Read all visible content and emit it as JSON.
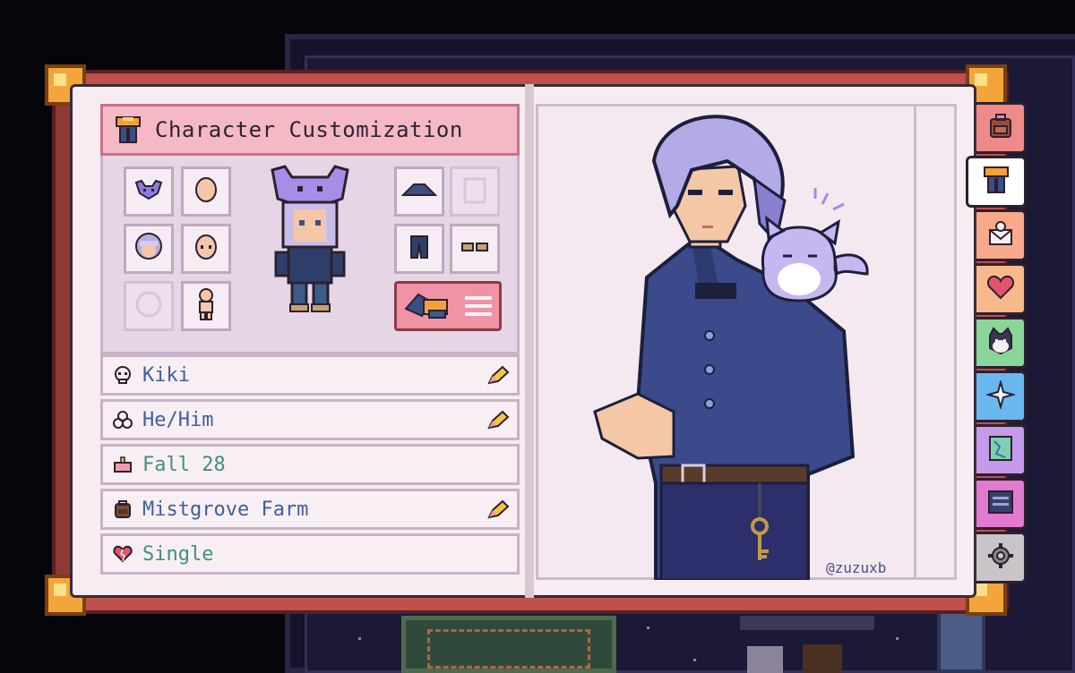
{
  "window": {
    "header_title": "Character Customization"
  },
  "customization": {
    "left_slots": [
      "cat-hat-icon",
      "bald-head-icon",
      "hair-icon",
      "face-icon",
      "empty-accessory-icon",
      "body-icon"
    ],
    "right_slots": [
      "hat-brim-icon",
      "locked-shirt-icon",
      "pants-icon",
      "shoes-icon"
    ],
    "wardrobe_button_icon": "clothes-pile-icon"
  },
  "profile": {
    "name": "Kiki",
    "pronouns": "He/Him",
    "birthday": "Fall 28",
    "farm": "Mistgrove Farm",
    "status": "Single"
  },
  "portrait": {
    "credit": "@zuzuxb"
  },
  "tabs": [
    "backpack-icon",
    "shirt-icon",
    "mail-icon",
    "heart-icon",
    "cat-face-icon",
    "sparkle-icon",
    "map-icon",
    "journal-icon",
    "gear-icon"
  ],
  "colors": {
    "accent_pink": "#f4b9c4",
    "text_blue": "#3f5f9c",
    "text_green": "#3f8f7c",
    "book_red": "#c0504b"
  }
}
